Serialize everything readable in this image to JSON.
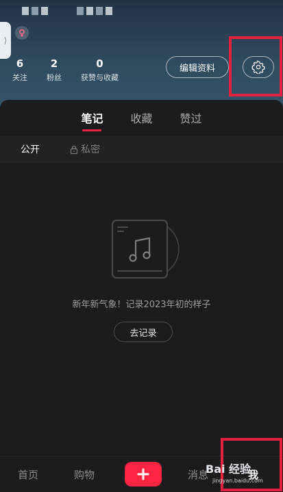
{
  "profile": {
    "stats": [
      {
        "num": "6",
        "label": "关注"
      },
      {
        "num": "2",
        "label": "粉丝"
      },
      {
        "num": "0",
        "label": "获赞与收藏"
      }
    ],
    "edit_label": "编辑资料"
  },
  "tabs": [
    "笔记",
    "收藏",
    "赞过"
  ],
  "subtabs": {
    "public": "公开",
    "private": "私密"
  },
  "empty": {
    "message": "新年新气象！记录2023年初的样子",
    "button": "去记录"
  },
  "nav": {
    "home": "首页",
    "shop": "购物",
    "msg": "消息",
    "me": "我"
  },
  "watermark": {
    "main": "Bai 经验",
    "sub": "jingyan.baidu.com"
  },
  "colors": {
    "accent": "#ff2442",
    "highlight": "#e8203f"
  }
}
